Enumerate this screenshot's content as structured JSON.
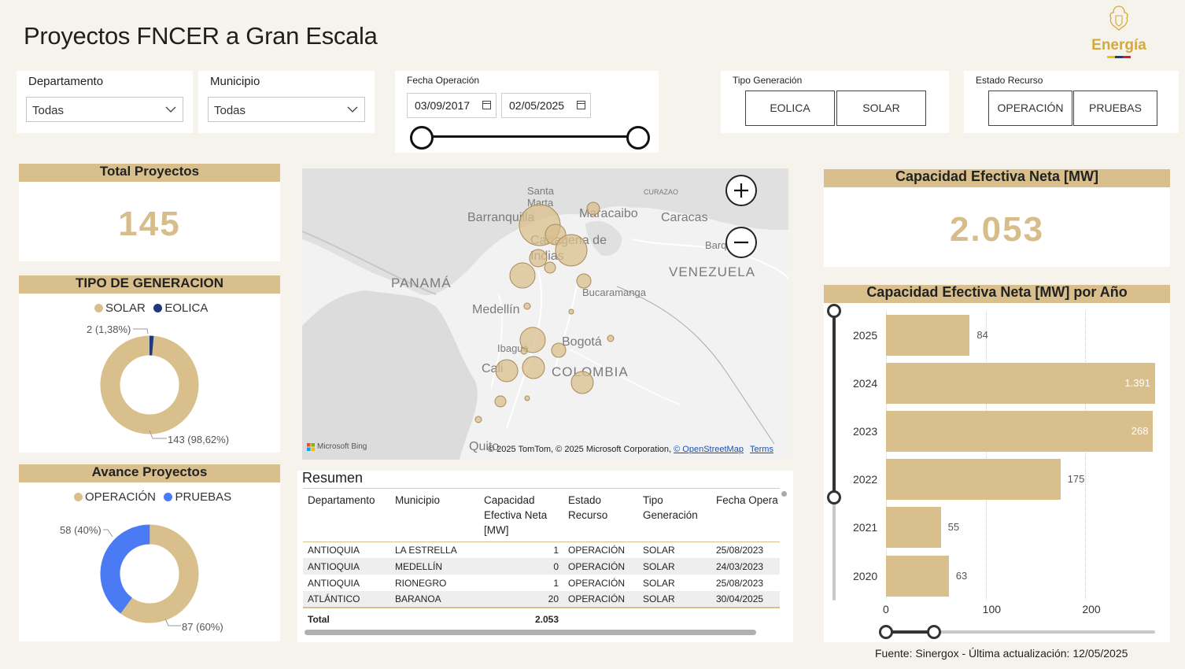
{
  "page": {
    "title": "Proyectos FNCER a Gran Escala"
  },
  "logo": {
    "text": "Energía",
    "flag_colors": [
      "#f4c20d",
      "#1a3a8f",
      "#d81e2b"
    ]
  },
  "filters": {
    "departamento": {
      "label": "Departamento",
      "value": "Todas"
    },
    "municipio": {
      "label": "Municipio",
      "value": "Todas"
    },
    "fecha": {
      "label": "Fecha Operación",
      "start": "03/09/2017",
      "end": "02/05/2025"
    },
    "tipo_generacion": {
      "label": "Tipo Generación",
      "options": [
        "EOLICA",
        "SOLAR"
      ]
    },
    "estado_recurso": {
      "label": "Estado Recurso",
      "options": [
        "OPERACIÓN",
        "PRUEBAS"
      ]
    }
  },
  "total_proyectos": {
    "title": "Total Proyectos",
    "value": "145"
  },
  "tipo_generacion_chart": {
    "title": "TIPO DE GENERACION",
    "legend": [
      {
        "name": "SOLAR",
        "color": "#d9bf8c"
      },
      {
        "name": "EOLICA",
        "color": "#1f3a7a"
      }
    ],
    "label_eolica": "2 (1,38%)",
    "label_solar": "143 (98,62%)"
  },
  "avance_proyectos": {
    "title": "Avance Proyectos",
    "legend": [
      {
        "name": "OPERACIÓN",
        "color": "#d9bf8c"
      },
      {
        "name": "PRUEBAS",
        "color": "#4a7bf5"
      }
    ],
    "label_pruebas": "58 (40%)",
    "label_operacion": "87 (60%)"
  },
  "map": {
    "labels": {
      "santa_marta": "Santa Marta",
      "barranquilla": "Barranquilla",
      "curazao": "CURAZAO",
      "maracaibo": "Maracaibo",
      "caracas": "Caracas",
      "cartagena": "Cartagena de Indias",
      "barq": "Barq",
      "panama": "PANAMÁ",
      "venezuela": "VENEZUELA",
      "bucaramanga": "Bucaramanga",
      "medellin": "Medellín",
      "bogota": "Bogotá",
      "ibague": "Ibagué",
      "colombia": "COLOMBIA",
      "cali": "Cali",
      "quito": "Quito"
    },
    "attribution": "© 2025 TomTom, © 2025 Microsoft Corporation,",
    "osm_link": "© OpenStreetMap",
    "terms_link": "Terms",
    "bing_logo": "Microsoft Bing"
  },
  "resumen": {
    "title": "Resumen",
    "columns": [
      "Departamento",
      "Municipio",
      "Capacidad Efectiva Neta [MW]",
      "Estado Recurso",
      "Tipo Generación",
      "Fecha Opera"
    ],
    "rows": [
      [
        "ANTIOQUIA",
        "LA ESTRELLA",
        "1",
        "OPERACIÓN",
        "SOLAR",
        "25/08/2023"
      ],
      [
        "ANTIOQUIA",
        "MEDELLÍN",
        "0",
        "OPERACIÓN",
        "SOLAR",
        "24/03/2023"
      ],
      [
        "ANTIOQUIA",
        "RIONEGRO",
        "1",
        "OPERACIÓN",
        "SOLAR",
        "25/08/2023"
      ],
      [
        "ATLÁNTICO",
        "BARANOA",
        "20",
        "OPERACIÓN",
        "SOLAR",
        "30/04/2025"
      ]
    ],
    "total_label": "Total",
    "total_value": "2.053"
  },
  "capacidad_total": {
    "title": "Capacidad Efectiva Neta [MW]",
    "value": "2.053"
  },
  "chart_data": {
    "type": "bar",
    "orientation": "horizontal",
    "title": "Capacidad Efectiva Neta [MW] por Año",
    "categories": [
      "2025",
      "2024",
      "2023",
      "2022",
      "2021",
      "2020"
    ],
    "values": [
      84,
      1391,
      268,
      175,
      55,
      63
    ],
    "value_labels": [
      "84",
      "1.391",
      "268",
      "175",
      "55",
      "63"
    ],
    "x_ticks": [
      "0",
      "100",
      "200"
    ],
    "xlim": [
      0,
      270
    ],
    "color": "#d9bf8c"
  },
  "footer": {
    "text": "Fuente: Sinergox - Última actualización: 12/05/2025"
  }
}
